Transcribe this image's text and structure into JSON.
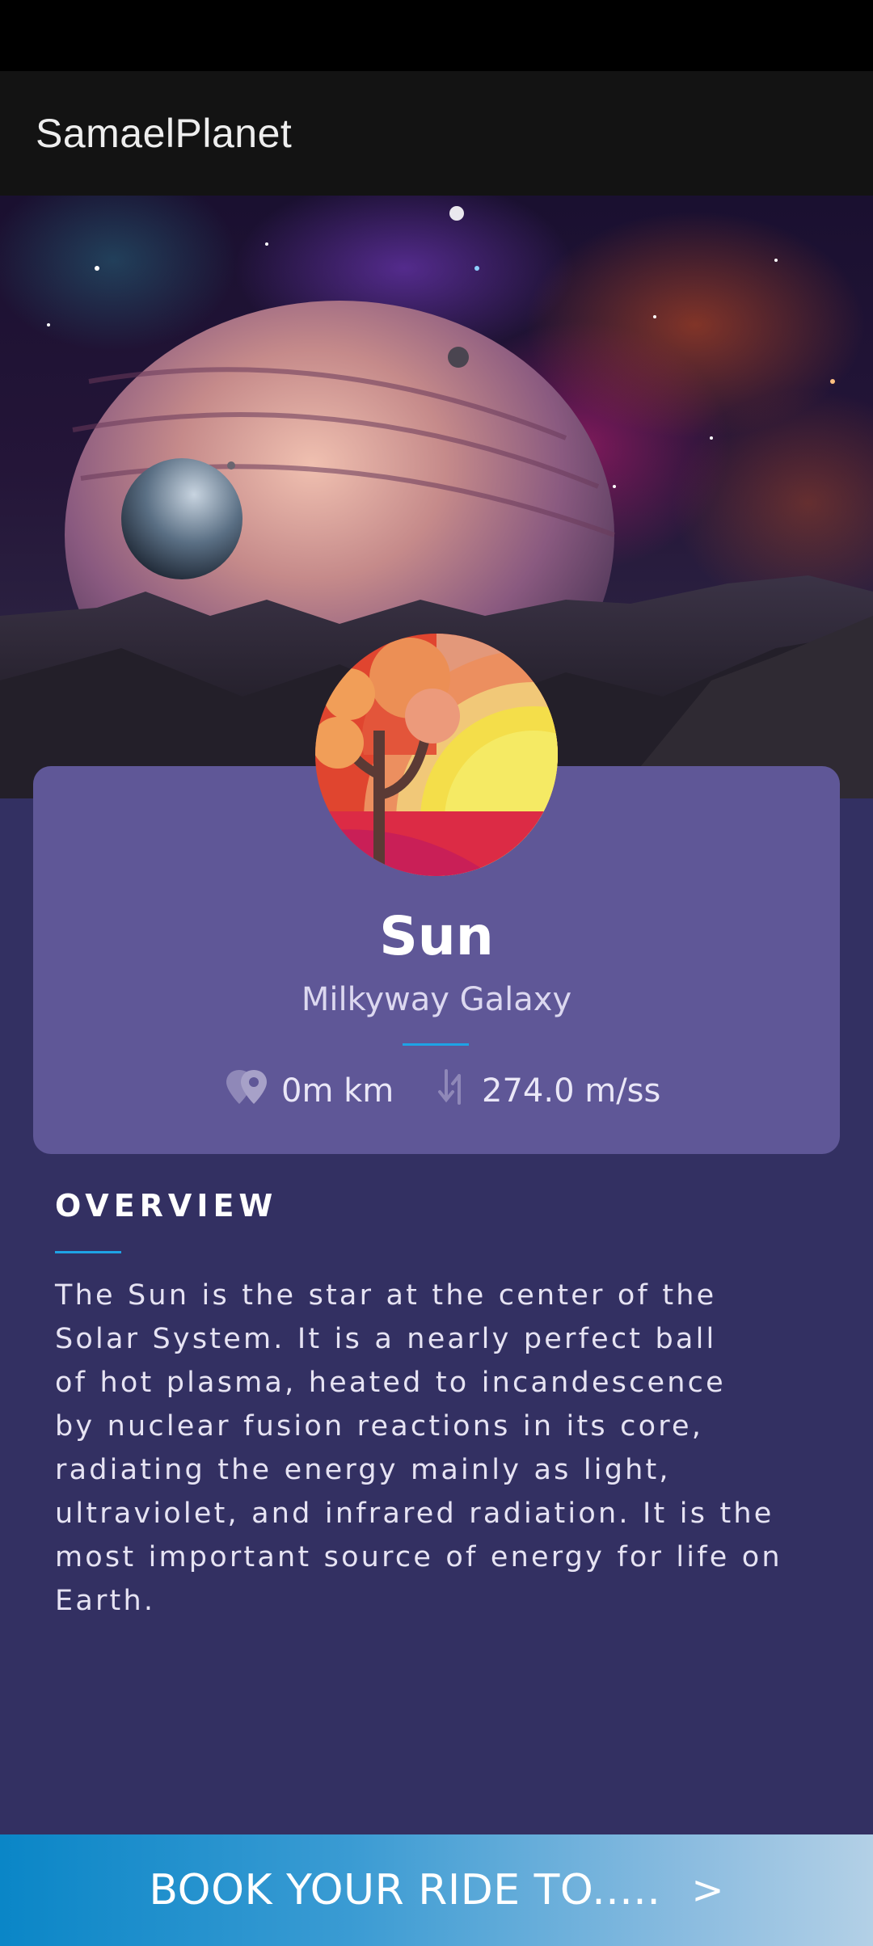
{
  "app": {
    "title": "SamaelPlanet"
  },
  "planet": {
    "name": "Sun",
    "galaxy": "Milkyway Galaxy",
    "distance": "0m km",
    "gravity": "274.0 m/ss",
    "distance_icon": "location-pin-icon",
    "gravity_icon": "arrows-down-up-icon"
  },
  "overview": {
    "title": "OVERVIEW",
    "lines": [
      "The Sun is the star at the center of the",
      "Solar System. It is a nearly perfect ball",
      "of hot plasma, heated to incandescence",
      "by nuclear fusion reactions in its core,",
      "radiating the energy mainly as light,",
      "ultraviolet, and infrared radiation. It is the",
      "most important source of energy for life on",
      "Earth."
    ]
  },
  "cta": {
    "label": "BOOK YOUR RIDE TO.....",
    "icon": "chevron-right-icon"
  },
  "colors": {
    "background": "#333062",
    "card": "#5f5797",
    "app_bar": "#131313",
    "accent": "#1ea3e6"
  }
}
